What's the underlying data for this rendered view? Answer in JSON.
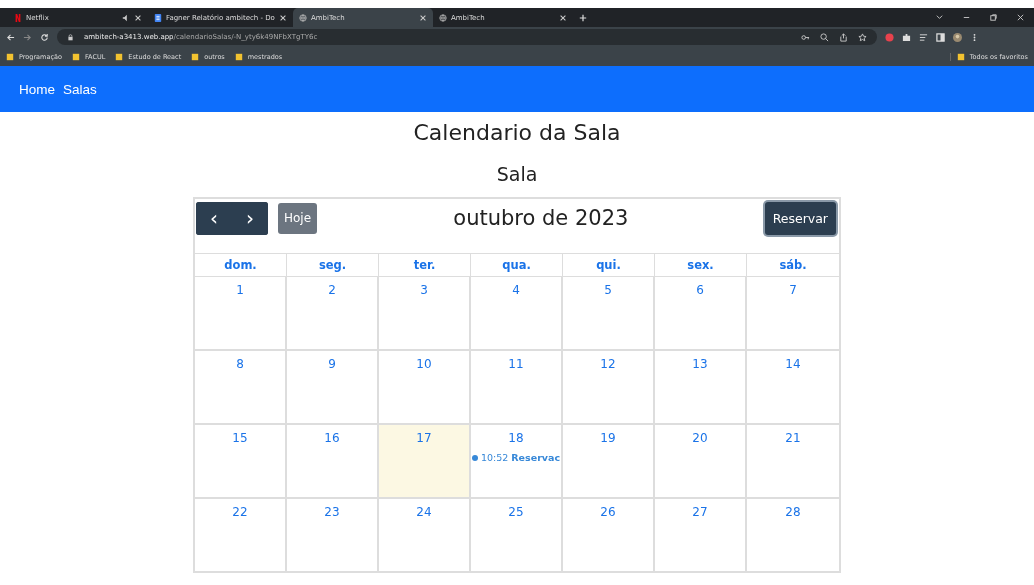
{
  "browser": {
    "tabs": [
      {
        "title": "Netflix",
        "kind": "netflix",
        "audio": true,
        "selected": false
      },
      {
        "title": "Fagner Relatório ambitech - Do",
        "kind": "doc",
        "audio": false,
        "selected": false
      },
      {
        "title": "AmbiTech",
        "kind": "globe",
        "audio": false,
        "selected": true
      },
      {
        "title": "AmbiTech",
        "kind": "globe",
        "audio": false,
        "selected": false
      }
    ],
    "url_host": "ambitech-a3413.web.app",
    "url_path": "/calendarioSalas/-N_yty6k49NFbXTgTY6c",
    "bookmarks": [
      "Programação",
      "FACUL",
      "Estudo de React",
      "outros",
      "mestrados"
    ],
    "all_bookmarks": "Todos os favoritos"
  },
  "navbar": {
    "links": [
      "Home",
      "Salas"
    ]
  },
  "title": "Calendario da Sala",
  "subtitle": "Sala",
  "toolbar": {
    "prev": "‹",
    "next": "›",
    "today": "Hoje",
    "month": "outubro de 2023",
    "reserve": "Reservar"
  },
  "weekdays": [
    "dom.",
    "seg.",
    "ter.",
    "qua.",
    "qui.",
    "sex.",
    "sáb."
  ],
  "weeks": [
    [
      {
        "day": "1",
        "today": false
      },
      {
        "day": "2",
        "today": false
      },
      {
        "day": "3",
        "today": false
      },
      {
        "day": "4",
        "today": false
      },
      {
        "day": "5",
        "today": false
      },
      {
        "day": "6",
        "today": false
      },
      {
        "day": "7",
        "today": false
      }
    ],
    [
      {
        "day": "8",
        "today": false
      },
      {
        "day": "9",
        "today": false
      },
      {
        "day": "10",
        "today": false
      },
      {
        "day": "11",
        "today": false
      },
      {
        "day": "12",
        "today": false
      },
      {
        "day": "13",
        "today": false
      },
      {
        "day": "14",
        "today": false
      }
    ],
    [
      {
        "day": "15",
        "today": false
      },
      {
        "day": "16",
        "today": false
      },
      {
        "day": "17",
        "today": true
      },
      {
        "day": "18",
        "today": false,
        "events": [
          {
            "time": "10:52",
            "title": "Reservac",
            "color": "#3788d8"
          }
        ]
      },
      {
        "day": "19",
        "today": false
      },
      {
        "day": "20",
        "today": false
      },
      {
        "day": "21",
        "today": false
      }
    ],
    [
      {
        "day": "22",
        "today": false
      },
      {
        "day": "23",
        "today": false
      },
      {
        "day": "24",
        "today": false
      },
      {
        "day": "25",
        "today": false
      },
      {
        "day": "26",
        "today": false
      },
      {
        "day": "27",
        "today": false
      },
      {
        "day": "28",
        "today": false
      }
    ]
  ]
}
